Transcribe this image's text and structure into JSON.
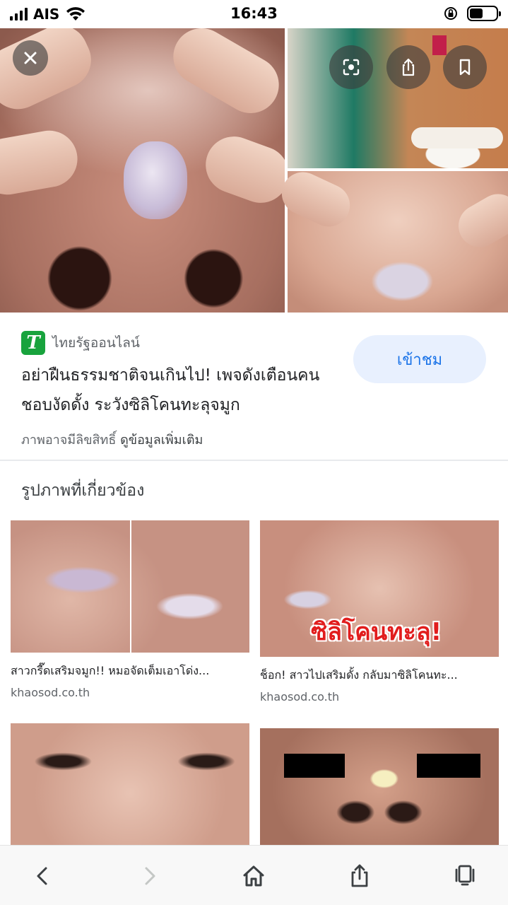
{
  "status_bar": {
    "carrier": "AIS",
    "time": "16:43"
  },
  "viewer": {
    "close_icon": "close-icon",
    "lens_icon": "lens-icon",
    "share_icon": "share-icon",
    "bookmark_icon": "bookmark-icon"
  },
  "source": {
    "logo_letter": "T",
    "name": "ไทยรัฐออนไลน์",
    "brand_color": "#18a33d"
  },
  "article": {
    "title": "อย่าฝืนธรรมชาติจนเกินไป! เพจดังเตือนคนชอบงัดดั้ง ระวังซิลิโคนทะลุจมูก",
    "visit_label": "เข้าชม",
    "copyright_text": "ภาพอาจมีลิขสิทธิ์",
    "more_info_link": "ดูข้อมูลเพิ่มเติม"
  },
  "related": {
    "heading": "รูปภาพที่เกี่ยวข้อง",
    "items": [
      {
        "title": "สาวกรี๊ดเสริมจมูก!! หมอจัดเต็มเอาโด่ง...",
        "domain": "khaosod.co.th"
      },
      {
        "title": "ช็อก! สาวไปเสริมดั้ง กลับมาซิลิโคนทะ...",
        "domain": "khaosod.co.th",
        "image_label": "ซิลิโคนทะลุ!"
      },
      {
        "title": "",
        "domain": ""
      },
      {
        "title": "",
        "domain": ""
      }
    ]
  },
  "toolbar": {
    "back_icon": "back-icon",
    "forward_icon": "forward-icon",
    "home_icon": "home-icon",
    "share_icon": "share-icon",
    "tabs_icon": "tabs-icon"
  },
  "colors": {
    "accent": "#1a73e8",
    "visit_button_bg": "#e8f0fe"
  }
}
